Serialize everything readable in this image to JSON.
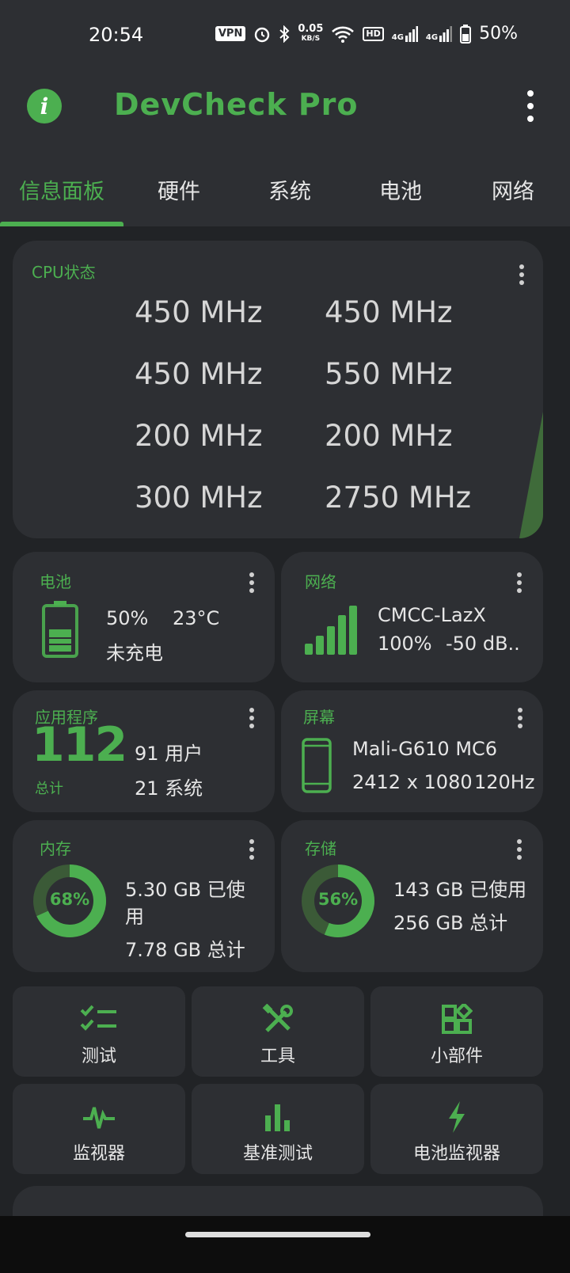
{
  "status": {
    "time": "20:54",
    "vpn": "VPN",
    "speed_value": "0.05",
    "speed_unit": "KB/S",
    "hd": "HD",
    "net1": "4G",
    "net2": "4G",
    "battery": "50%"
  },
  "app": {
    "title": "DevCheck Pro",
    "logo_letter": "i"
  },
  "tabs": [
    {
      "label": "信息面板"
    },
    {
      "label": "硬件"
    },
    {
      "label": "系统"
    },
    {
      "label": "电池"
    },
    {
      "label": "网络"
    }
  ],
  "cpu": {
    "title": "CPU状态",
    "cores": [
      "450 MHz",
      "450 MHz",
      "450 MHz",
      "550 MHz",
      "200 MHz",
      "200 MHz",
      "300 MHz",
      "2750 MHz"
    ]
  },
  "battery": {
    "title": "电池",
    "level": "50%",
    "temp": "23°C",
    "state": "未充电",
    "fill_fraction": 0.5
  },
  "network": {
    "title": "网络",
    "ssid": "CMCC-LazX",
    "strength": "100%",
    "signal": "-50 dB.."
  },
  "apps": {
    "title": "应用程序",
    "total": "112",
    "total_label": "总计",
    "user": "91 用户",
    "system": "21 系统"
  },
  "display": {
    "title": "屏幕",
    "gpu": "Mali-G610 MC6",
    "resolution": "2412 x 1080",
    "refresh": "120Hz"
  },
  "memory": {
    "title": "内存",
    "percent": "68%",
    "fraction": 0.68,
    "used_line1": "5.30 GB 已使",
    "used_line2": "用",
    "total": "7.78 GB 总计"
  },
  "storage": {
    "title": "存储",
    "percent": "56%",
    "fraction": 0.56,
    "used": "143 GB 已使用",
    "total": "256 GB 总计"
  },
  "shortcuts": [
    {
      "label": "测试",
      "icon": "checklist-icon"
    },
    {
      "label": "工具",
      "icon": "tools-icon"
    },
    {
      "label": "小部件",
      "icon": "widgets-icon"
    },
    {
      "label": "监视器",
      "icon": "pulse-icon"
    },
    {
      "label": "基准测试",
      "icon": "bar-chart-icon"
    },
    {
      "label": "电池监视器",
      "icon": "bolt-icon"
    }
  ],
  "colors": {
    "accent": "#4caf50",
    "card": "#2d2f33",
    "background": "#212326"
  }
}
